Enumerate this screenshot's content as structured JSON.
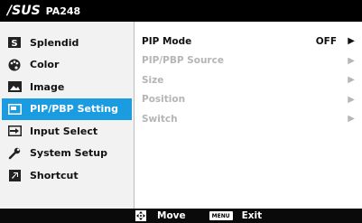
{
  "header": {
    "brand": "/SUS",
    "model": "PA248"
  },
  "sidebar": {
    "items": [
      {
        "label": "Splendid",
        "icon": "splendid-s-icon",
        "active": false
      },
      {
        "label": "Color",
        "icon": "palette-icon",
        "active": false
      },
      {
        "label": "Image",
        "icon": "picture-icon",
        "active": false
      },
      {
        "label": "PIP/PBP Setting",
        "icon": "pip-icon",
        "active": true
      },
      {
        "label": "Input Select",
        "icon": "input-arrow-icon",
        "active": false
      },
      {
        "label": "System Setup",
        "icon": "wrench-icon",
        "active": false
      },
      {
        "label": "Shortcut",
        "icon": "shortcut-icon",
        "active": false
      }
    ]
  },
  "content": {
    "rows": [
      {
        "label": "PIP Mode",
        "value": "OFF",
        "arrow": "▶",
        "enabled": true
      },
      {
        "label": "PIP/PBP Source",
        "value": "",
        "arrow": "▶",
        "enabled": false
      },
      {
        "label": "Size",
        "value": "",
        "arrow": "▶",
        "enabled": false
      },
      {
        "label": "Position",
        "value": "",
        "arrow": "▶",
        "enabled": false
      },
      {
        "label": "Switch",
        "value": "",
        "arrow": "▶",
        "enabled": false
      }
    ]
  },
  "footer": {
    "move_label": "Move",
    "menu_badge": "MENU",
    "exit_label": "Exit"
  },
  "colors": {
    "accent": "#1b9be0",
    "disabled_text": "#b5b5b5",
    "sidebar_bg": "#f2f2f2"
  }
}
